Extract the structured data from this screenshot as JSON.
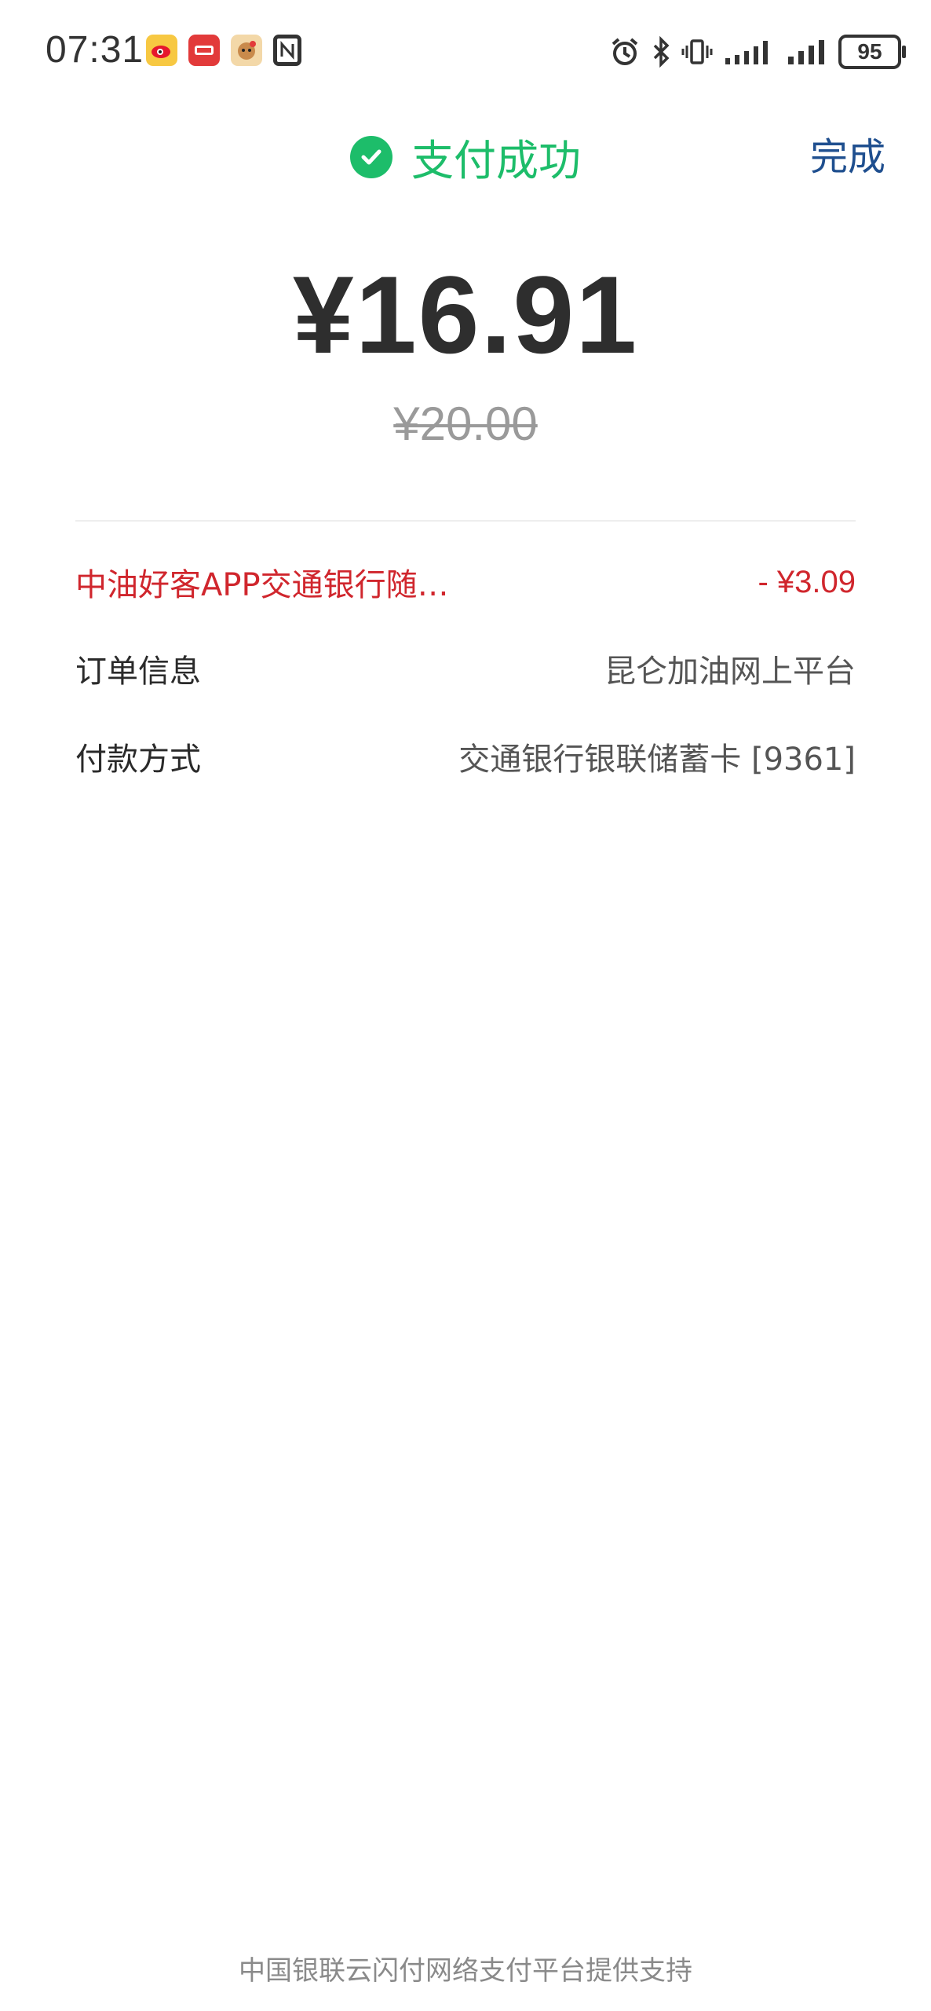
{
  "status_bar": {
    "time": "07:31",
    "battery": "95",
    "app_icons": [
      "weibo-icon",
      "unionpay-app-icon",
      "dog-app-icon",
      "nfc-icon"
    ],
    "system_icons": [
      "alarm-icon",
      "bluetooth-icon",
      "vibrate-icon",
      "signal-icon",
      "signal-icon"
    ]
  },
  "header": {
    "title": "支付成功",
    "done_label": "完成",
    "accent_color": "#1dbd6a"
  },
  "payment": {
    "amount": "¥16.91",
    "original_amount": "¥20.00"
  },
  "details": {
    "discount": {
      "label": "中油好客APP交通银行随…",
      "value": "- ¥3.09"
    },
    "order": {
      "label": "订单信息",
      "value": "昆仑加油网上平台"
    },
    "payment_method": {
      "label": "付款方式",
      "value": "交通银行银联储蓄卡 [9361]"
    }
  },
  "footer": {
    "text": "中国银联云闪付网络支付平台提供支持"
  },
  "colors": {
    "discount_red": "#d0262d",
    "done_blue": "#1f4f8f"
  }
}
